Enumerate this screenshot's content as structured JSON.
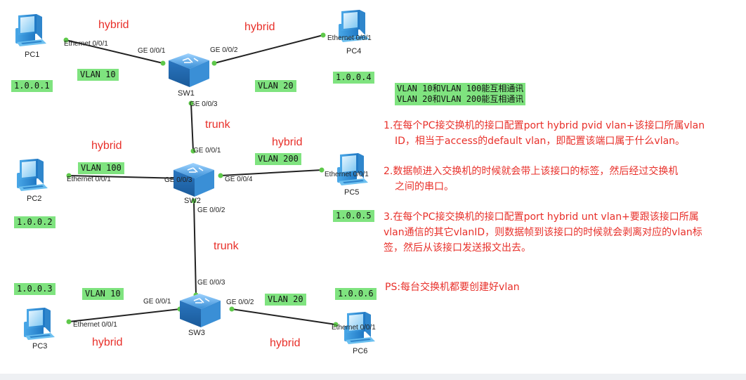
{
  "devices": {
    "pc1": "PC1",
    "pc2": "PC2",
    "pc3": "PC3",
    "pc4": "PC4",
    "pc5": "PC5",
    "pc6": "PC6",
    "sw1": "SW1",
    "sw2": "SW2",
    "sw3": "SW3"
  },
  "ports": {
    "pc1_eth": "Ethernet 0/0/1",
    "pc4_eth": "Ethernet 0/0/1",
    "pc2_eth": "Ethernet 0/0/1",
    "pc5_eth": "Ethernet 0/0/1",
    "pc3_eth": "Ethernet 0/0/1",
    "pc6_eth": "Ethernet 0/0/1",
    "sw1_ge1": "GE 0/0/1",
    "sw1_ge2": "GE 0/0/2",
    "sw1_ge3": "GE 0/0/3",
    "sw2_ge1": "GE 0/0/1",
    "sw2_ge3": "GE 0/0/3",
    "sw2_ge4": "GE 0/0/4",
    "sw2_ge2": "GE 0/0/2",
    "sw3_ge3": "GE 0/0/3",
    "sw3_ge1": "GE 0/0/1",
    "sw3_ge2": "GE 0/0/2"
  },
  "link_modes": {
    "pc1": "hybrid",
    "pc4": "hybrid",
    "pc2": "hybrid",
    "pc5": "hybrid",
    "pc3": "hybrid",
    "pc6": "hybrid",
    "sw1_sw2": "trunk",
    "sw2_sw3": "trunk"
  },
  "vlans": {
    "pc1": "VLAN 10",
    "pc4": "VLAN 20",
    "pc2": "VLAN 100",
    "pc5": "VLAN 200",
    "pc3": "VLAN 10",
    "pc6": "VLAN 20"
  },
  "ips": {
    "pc1": "1.0.0.1",
    "pc4": "1.0.0.4",
    "pc2": "1.0.0.2",
    "pc5": "1.0.0.5",
    "pc3": "1.0.0.3",
    "pc6": "1.0.0.6"
  },
  "legend": {
    "line1": "VLAN 10和VLAN 100能互相通讯",
    "line2": "VLAN 20和VLAN 200能互相通讯"
  },
  "notes": {
    "n1_line1": "1.在每个PC接交换机的接口配置port hybrid pvid vlan+该接口所属vlan",
    "n1_line2": "ID，相当于access的default vlan，即配置该端口属于什么vlan。",
    "n2_line1": "2.数据帧进入交换机的时候就会带上该接口的标签，然后经过交换机",
    "n2_line2": "之间的串口。",
    "n3_line1": "3.在每个PC接交换机的接口配置port hybrid unt vlan+要跟该接口所属",
    "n3_line2": "vlan通信的其它vlanID，则数据帧到该接口的时候就会剥离对应的vlan标",
    "n3_line3": "签，然后从该接口发送报文出去。",
    "ps": "PS:每台交换机都要创建好vlan"
  },
  "colors": {
    "tag_bg": "#7fe37f",
    "mode_text": "#e8302a",
    "port_dot": "#5ec84a",
    "link": "#222222",
    "switch_blue": "#3a8fd6"
  }
}
